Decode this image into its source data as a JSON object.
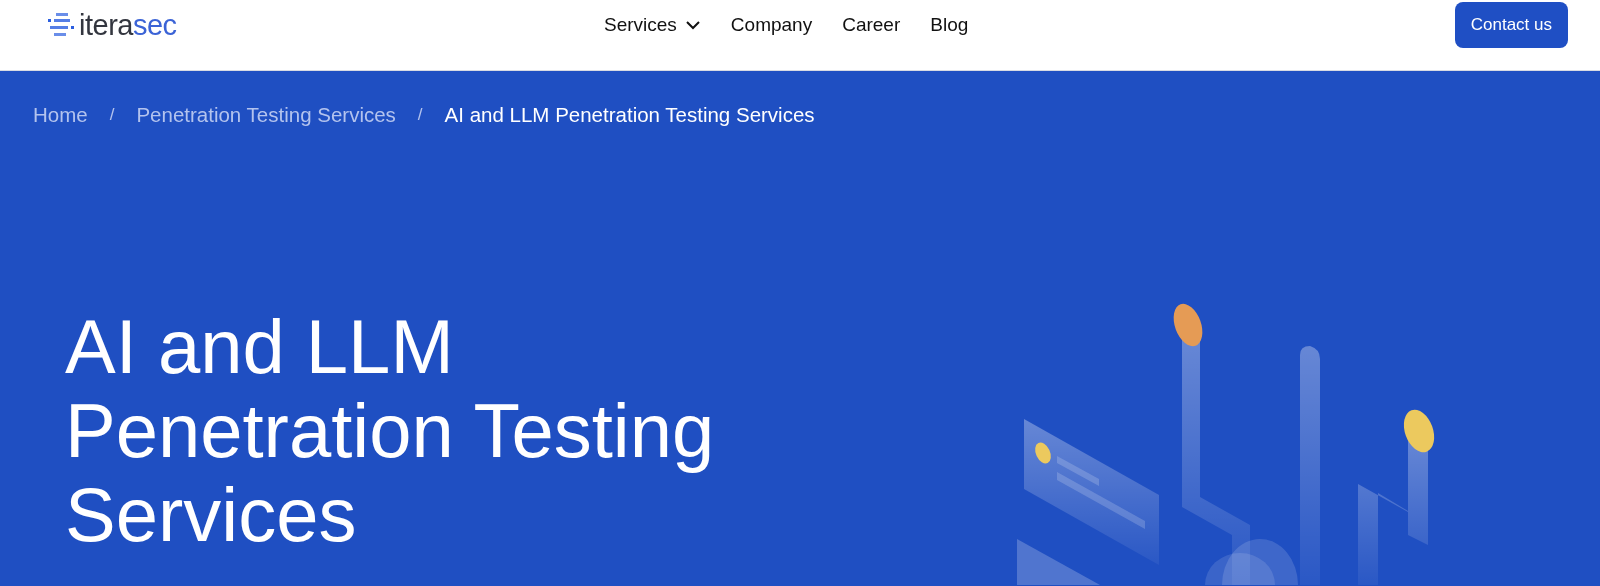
{
  "header": {
    "logo": {
      "dark": "itera",
      "accent": "sec"
    },
    "nav": [
      {
        "label": "Services",
        "dropdown": true
      },
      {
        "label": "Company",
        "dropdown": false
      },
      {
        "label": "Career",
        "dropdown": false
      },
      {
        "label": "Blog",
        "dropdown": false
      }
    ],
    "contact_button": "Contact us"
  },
  "breadcrumb": [
    {
      "label": "Home",
      "selected": false
    },
    {
      "label": "Penetration Testing Services",
      "selected": false
    },
    {
      "label": "AI and LLM Penetration Testing Services",
      "selected": true
    }
  ],
  "breadcrumb_separator": "/",
  "hero": {
    "title_lines": [
      "AI and LLM",
      "Penetration Testing",
      "Services"
    ]
  }
}
